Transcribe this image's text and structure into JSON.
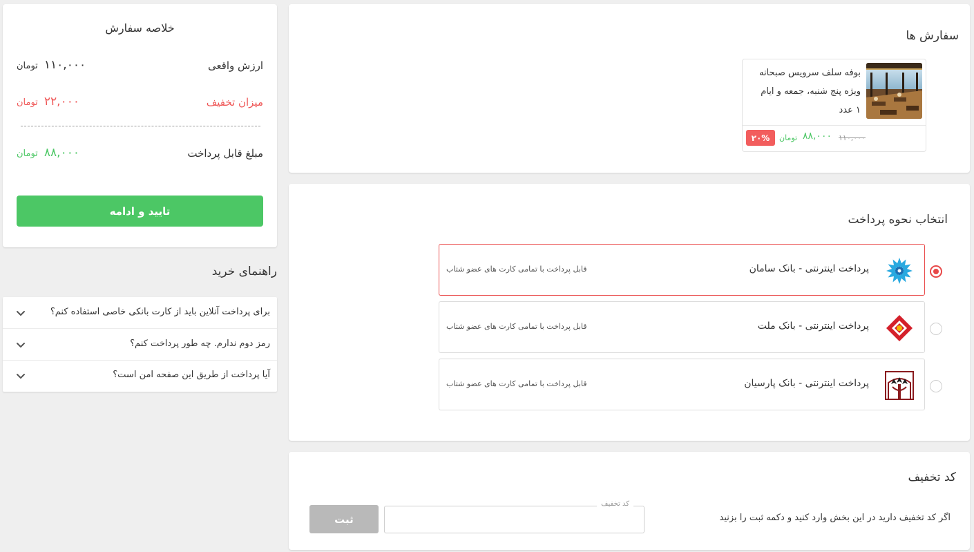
{
  "orders": {
    "title": "سفارش ها",
    "items": [
      {
        "line1": "بوفه سلف سرویس صبحانه",
        "line2": "ویژه پنج شنبه، جمعه و ایام",
        "quantity": "۱ عدد",
        "old_price": "۱۱۰,۰۰۰",
        "new_price": "۸۸,۰۰۰",
        "currency": "تومان",
        "discount": "۲۰%"
      }
    ]
  },
  "payment": {
    "title": "انتخاب نحوه پرداخت",
    "selected": 0,
    "banks": [
      {
        "name": "پرداخت اینترنتی - بانک سامان",
        "desc": "قابل پرداخت با تمامی کارت های عضو شتاب",
        "logo": "saman-bank-logo"
      },
      {
        "name": "پرداخت اینترنتی - بانک ملت",
        "desc": "قابل پرداخت با تمامی کارت های عضو شتاب",
        "logo": "mellat-bank-logo"
      },
      {
        "name": "پرداخت اینترنتی - بانک پارسیان",
        "desc": "قابل پرداخت با تمامی کارت های عضو شتاب",
        "logo": "parsian-bank-logo"
      }
    ]
  },
  "coupon": {
    "title": "کد تخفیف",
    "description": "اگر کد تخفیف دارید در این بخش وارد کنید و دکمه ثبت را بزنید",
    "input_label": "کد تخفیف",
    "input_value": "",
    "submit_label": "ثبت"
  },
  "summary": {
    "title": "خلاصه سفارش",
    "real_value_label": "ارزش واقعی",
    "real_value": "۱۱۰,۰۰۰",
    "discount_label": "میزان تخفیف",
    "discount_value": "۲۲,۰۰۰",
    "payable_label": "مبلغ قابل پرداخت",
    "payable_value": "۸۸,۰۰۰",
    "currency": "تومان",
    "confirm_label": "تایید و ادامه"
  },
  "guide": {
    "title": "راهنمای خرید",
    "faqs": [
      "برای پرداخت آنلاین باید از کارت بانکی خاصی استفاده کنم؟",
      "رمز دوم ندارم. چه طور پرداخت کنم؟",
      "آیا پرداخت از طریق این صفحه امن است؟"
    ]
  },
  "colors": {
    "accent_green": "#4cc765",
    "accent_red": "#ea4d4d",
    "disabled_gray": "#b9b9b9",
    "background": "#efefef"
  }
}
